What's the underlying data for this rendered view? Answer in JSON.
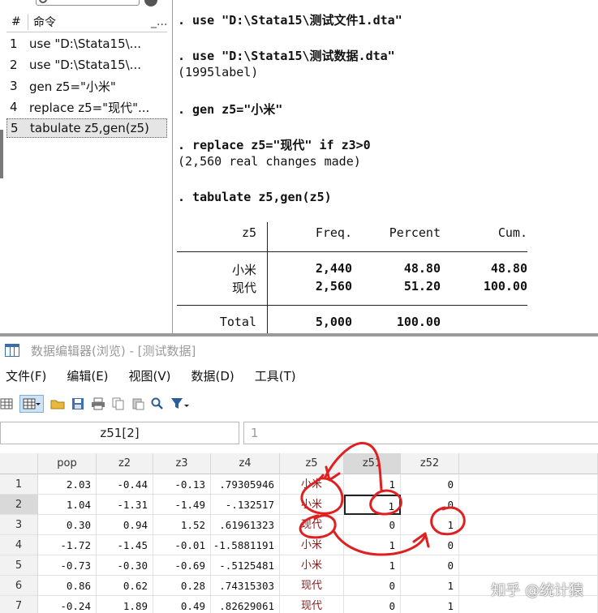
{
  "history": {
    "header": {
      "hash": "#",
      "command": "命令",
      "more": "_..."
    },
    "rows": [
      {
        "n": "1",
        "cmd": "use \"D:\\Stata15\\..."
      },
      {
        "n": "2",
        "cmd": "use \"D:\\Stata15\\..."
      },
      {
        "n": "3",
        "cmd": "gen z5=\"小米\""
      },
      {
        "n": "4",
        "cmd": "replace z5=\"现代\"..."
      },
      {
        "n": "5",
        "cmd": "tabulate z5,gen(z5)"
      }
    ]
  },
  "results": {
    "lines": [
      ". use \"D:\\Stata15\\测试文件1.dta\"",
      ". use \"D:\\Stata15\\测试数据.dta\"",
      "(1995label)",
      ". gen z5=\"小米\"",
      ". replace z5=\"现代\" if z3>0",
      "(2,560 real changes made)",
      ". tabulate z5,gen(z5)"
    ],
    "table": {
      "headers": [
        "z5",
        "Freq.",
        "Percent",
        "Cum."
      ],
      "rows": [
        [
          "小米",
          "2,440",
          "48.80",
          "48.80"
        ],
        [
          "现代",
          "2,560",
          "51.20",
          "100.00"
        ]
      ],
      "total": [
        "Total",
        "5,000",
        "100.00"
      ]
    }
  },
  "editor": {
    "title": "数据编辑器(浏览) - [测试数据]",
    "menu": [
      "文件(F)",
      "编辑(E)",
      "视图(V)",
      "数据(D)",
      "工具(T)"
    ],
    "cell_name": "z51[2]",
    "cell_value": "1",
    "columns": [
      "pop",
      "z2",
      "z3",
      "z4",
      "z5",
      "z51",
      "z52"
    ],
    "rows": [
      [
        "1",
        "2.03",
        "-0.44",
        "-0.13",
        ".79305946",
        "小米",
        "1",
        "0"
      ],
      [
        "2",
        "1.04",
        "-1.31",
        "-1.49",
        "-.132517",
        "小米",
        "1",
        "0"
      ],
      [
        "3",
        "0.30",
        "0.94",
        "1.52",
        ".61961323",
        "现代",
        "0",
        "1"
      ],
      [
        "4",
        "-1.72",
        "-1.45",
        "-0.01",
        "-1.5881191",
        "小米",
        "1",
        "0"
      ],
      [
        "5",
        "-0.73",
        "-0.30",
        "-0.69",
        "-.5125481",
        "小米",
        "1",
        "0"
      ],
      [
        "6",
        "0.86",
        "0.62",
        "0.28",
        ".74315303",
        "现代",
        "0",
        "1"
      ],
      [
        "7",
        "-0.24",
        "1.89",
        "0.49",
        ".82629061",
        "现代",
        "0",
        "1"
      ]
    ]
  },
  "watermark": "知乎 @统计猿",
  "colors": {
    "label_text": "#8b1a1a",
    "annotation": "#e02020",
    "toolbar_active": "#cfe3f7"
  },
  "icons": [
    "grid-icon",
    "search-icon",
    "clear-icon",
    "table-icon",
    "folder-icon",
    "save-icon",
    "print-icon",
    "copy-icon",
    "paste-icon",
    "find-icon",
    "filter-icon",
    "dropdown-icon"
  ]
}
